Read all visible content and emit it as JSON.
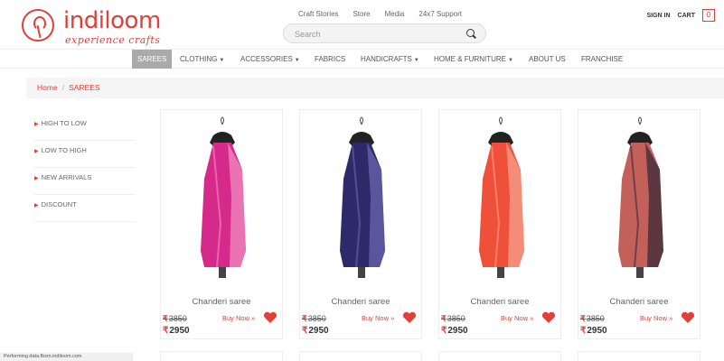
{
  "brand": {
    "name": "indiloom",
    "tagline": "experience crafts",
    "accent": "#e0403a"
  },
  "toplinks": [
    "Craft Stories",
    "Store",
    "Media",
    "24x7 Support"
  ],
  "search": {
    "placeholder": "Search"
  },
  "account": {
    "signin": "SIGN IN",
    "cart": "CART",
    "cart_count": "0"
  },
  "nav": [
    {
      "label": "SAREES",
      "active": true
    },
    {
      "label": "CLOTHING",
      "caret": true
    },
    {
      "label": "ACCESSORIES",
      "caret": true
    },
    {
      "label": "FABRICS"
    },
    {
      "label": "HANDICRAFTS",
      "caret": true
    },
    {
      "label": "HOME & FURNITURE",
      "caret": true
    },
    {
      "label": "ABOUT US"
    },
    {
      "label": "FRANCHISE"
    }
  ],
  "breadcrumb": {
    "home": "Home",
    "separator": "/",
    "current": "SAREES"
  },
  "filters": [
    "HIGH TO LOW",
    "LOW TO HIGH",
    "NEW ARRIVALS",
    "DISCOUNT"
  ],
  "products": [
    {
      "name": "Chanderi saree",
      "old_price": "3850",
      "price": "2950",
      "buy": "Buy Now",
      "color": "#d62a8a",
      "accent": "#f08cc0"
    },
    {
      "name": "Chanderi saree",
      "old_price": "3850",
      "price": "2950",
      "buy": "Buy Now",
      "color": "#2e2a6a",
      "accent": "#6a66b0"
    },
    {
      "name": "Chanderi saree",
      "old_price": "3850",
      "price": "2950",
      "buy": "Buy Now",
      "color": "#f0503a",
      "accent": "#f7a08c"
    },
    {
      "name": "Chanderi saree",
      "old_price": "3850",
      "price": "2950",
      "buy": "Buy Now",
      "color": "#c4605a",
      "accent": "#3a2a3a"
    }
  ],
  "currency_symbol": "₹",
  "status_text": "Performing data.fbsm.indiloom.com"
}
